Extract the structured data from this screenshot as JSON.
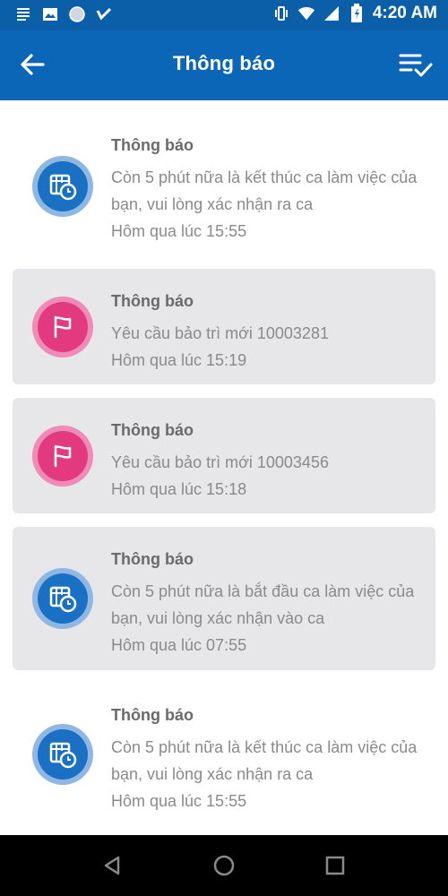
{
  "status_bar": {
    "time": "4:20 AM",
    "left_icons": [
      "menu-lines-icon",
      "image-icon",
      "circle-icon",
      "check-badge-icon"
    ],
    "right_icons": [
      "vibrate-icon",
      "wifi-icon",
      "signal-icon",
      "battery-icon"
    ]
  },
  "app_bar": {
    "title": "Thông báo",
    "back_icon": "arrow-left-icon",
    "action_icon": "mark-all-read-icon"
  },
  "notifications": [
    {
      "title": "Thông báo",
      "message": "Còn 5 phút nữa là kết thúc ca làm việc của bạn, vui lòng xác nhận ra ca",
      "time": "Hôm qua lúc 15:55",
      "icon": "calendar-clock-icon",
      "color": "blue",
      "read": false
    },
    {
      "title": "Thông báo",
      "message": "Yêu cầu bảo trì mới 10003281",
      "time": "Hôm qua lúc 15:19",
      "icon": "flag-icon",
      "color": "pink",
      "read": true
    },
    {
      "title": "Thông báo",
      "message": "Yêu cầu bảo trì mới 10003456",
      "time": "Hôm qua lúc 15:18",
      "icon": "flag-icon",
      "color": "pink",
      "read": true
    },
    {
      "title": "Thông báo",
      "message": "Còn 5 phút nữa là bắt đầu ca làm việc của bạn, vui lòng xác nhận vào ca",
      "time": "Hôm qua lúc 07:55",
      "icon": "calendar-clock-icon",
      "color": "blue",
      "read": true
    },
    {
      "title": "Thông báo",
      "message": "Còn 5 phút nữa là kết thúc ca làm việc của bạn, vui lòng xác nhận ra ca",
      "time": "Hôm qua lúc 15:55",
      "icon": "calendar-clock-icon",
      "color": "blue",
      "read": false
    }
  ],
  "nav_bar": {
    "icons": [
      "back-triangle-icon",
      "home-circle-icon",
      "recents-square-icon"
    ]
  },
  "colors": {
    "primary": "#0b66b8",
    "status": "#0b5fa8",
    "blue_icon": "#1a70c2",
    "pink_icon": "#e2397f",
    "read_bg": "#e7e6e9"
  }
}
